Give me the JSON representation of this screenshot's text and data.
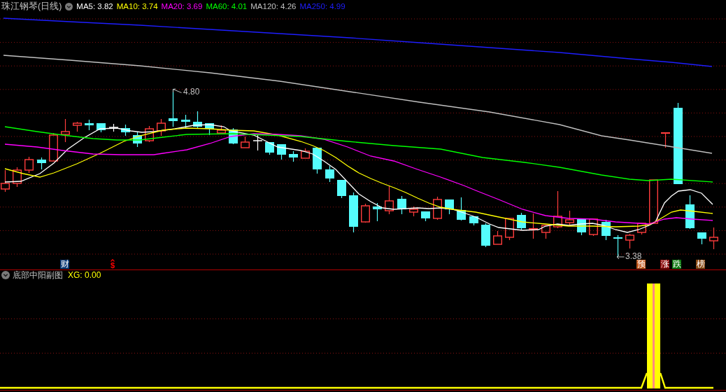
{
  "header": {
    "title": "珠江钢琴(日线)",
    "indicators": [
      {
        "label": "MA5: 3.82",
        "color": "#ffffff"
      },
      {
        "label": "MA10: 3.74",
        "color": "#ffff00"
      },
      {
        "label": "MA20: 3.69",
        "color": "#ff00ff"
      },
      {
        "label": "MA60: 4.01",
        "color": "#00ff00"
      },
      {
        "label": "MA120: 4.26",
        "color": "#c0c0c0"
      },
      {
        "label": "MA250: 4.99",
        "color": "#1e1eff"
      }
    ]
  },
  "main_chart": {
    "high_label": "4.80",
    "low_label": "3.38",
    "markers": [
      {
        "kind": "badge",
        "text": "财",
        "color": "#0f3c78"
      },
      {
        "kind": "symbol",
        "text": "$",
        "color": "#ff0000"
      },
      {
        "kind": "badge",
        "text": "预",
        "color": "#c0561a"
      },
      {
        "kind": "badge",
        "text": "涨",
        "color": "#8c0a0a"
      },
      {
        "kind": "badge",
        "text": "跌",
        "color": "#0f7a12"
      },
      {
        "kind": "badge",
        "text": "榜",
        "color": "#8a4a14"
      }
    ]
  },
  "sub_chart": {
    "title": "底部中阳副图",
    "reading": "XG: 0.00"
  }
}
